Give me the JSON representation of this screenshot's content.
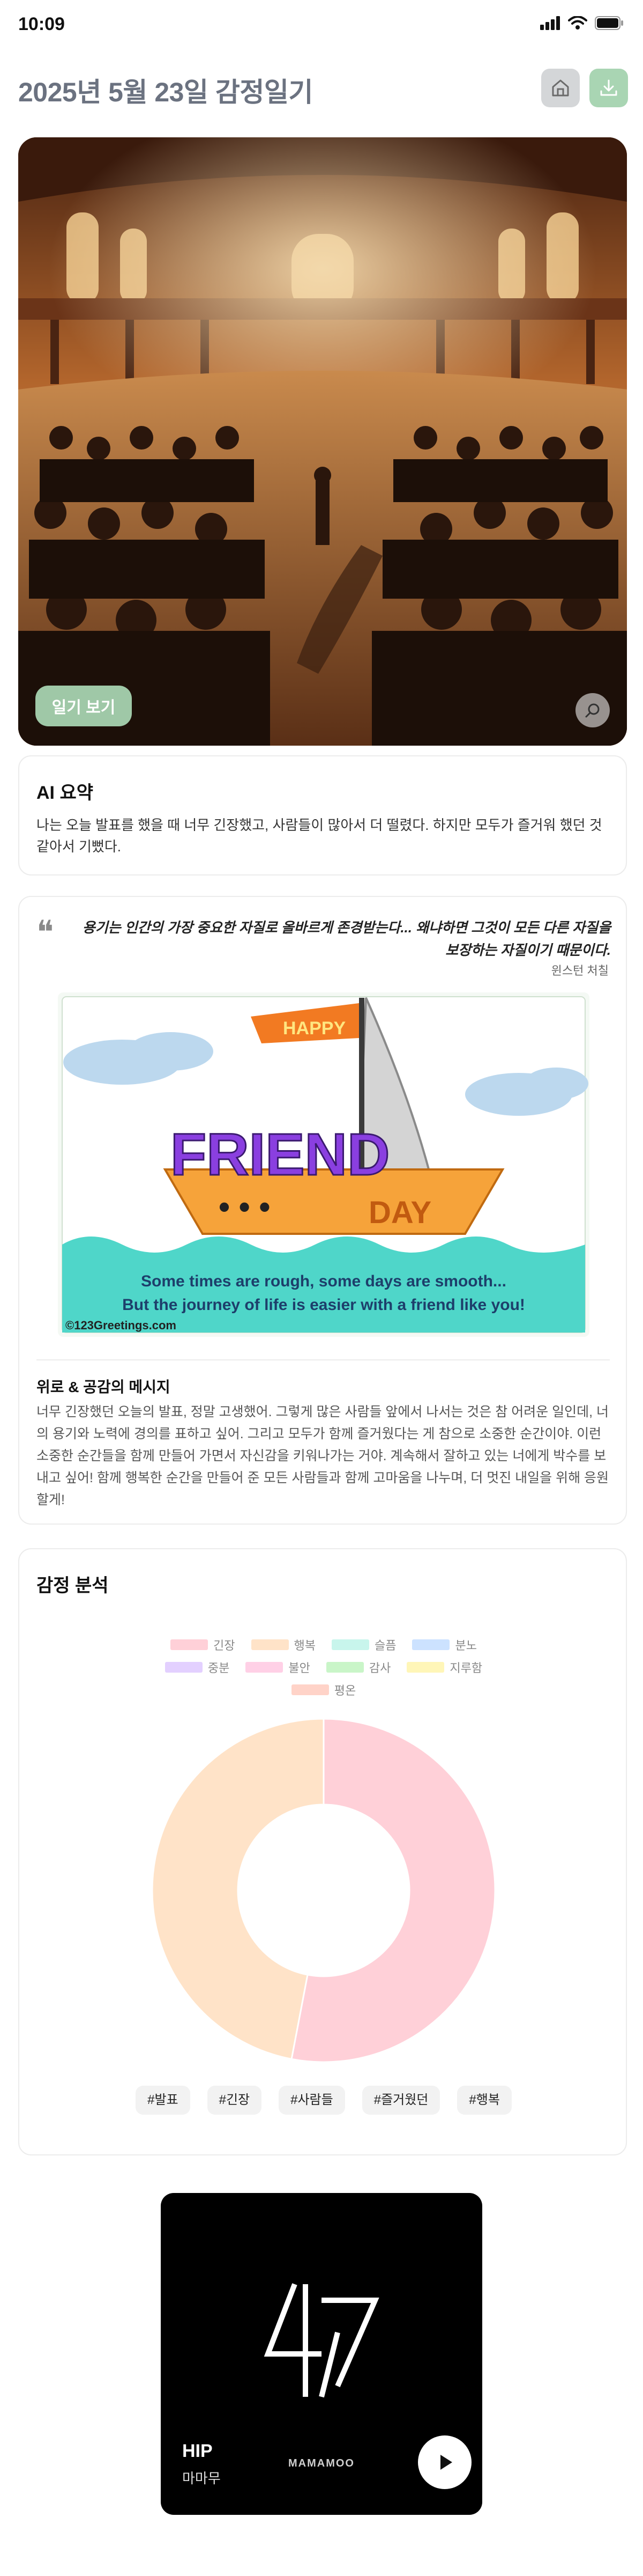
{
  "status_bar": {
    "time": "10:09"
  },
  "header": {
    "title": "2025년 5월 23일 감정일기"
  },
  "hero": {
    "diary_button": "일기 보기"
  },
  "ai_summary": {
    "title": "AI 요약",
    "text": "나는 오늘 발표를 했을 때 너무 긴장했고, 사람들이 많아서 더 떨렸다. 하지만 모두가 즐거워 했던 것 같아서 기뻤다."
  },
  "quote": {
    "text": "용기는 인간의 가장 중요한 자질로 올바르게 존경받는다... 왜냐하면 그것이 모든 다른 자질을 보장하는 자질이기 때문이다.",
    "author": "윈스턴 처칠"
  },
  "greeting_card": {
    "flag": "HAPPY",
    "word1": "FRIEND",
    "word2": "DAY",
    "line1": "Some times are rough, some days are smooth...",
    "line2": "But the journey of life is easier with a friend like you!",
    "credit": "©123Greetings.com"
  },
  "comfort": {
    "title": "위로 & 공감의 메시지",
    "text": "너무 긴장했던 오늘의 발표, 정말 고생했어. 그렇게 많은 사람들 앞에서 나서는 것은 참 어려운 일인데, 너의 용기와 노력에 경의를 표하고 싶어. 그리고 모두가 함께 즐거웠다는 게 참으로 소중한 순간이야. 이런 소중한 순간들을 함께 만들어 가면서 자신감을 키워나가는 거야. 계속해서 잘하고 있는 너에게 박수를 보내고 싶어! 함께 행복한 순간을 만들어 준 모든 사람들과 함께 고마움을 나누며, 더 멋진 내일을 위해 응원할게!"
  },
  "emotion": {
    "title": "감정 분석",
    "tags": [
      "#발표",
      "#긴장",
      "#사람들",
      "#즐거웠던",
      "#행복"
    ]
  },
  "chart_data": {
    "type": "pie",
    "legend": [
      "긴장",
      "행복",
      "슬픔",
      "분노",
      "중분",
      "불안",
      "감사",
      "지루함",
      "평온"
    ],
    "colors": [
      "#ffd0d8",
      "#ffe3c8",
      "#c8f5ec",
      "#cce2ff",
      "#e3d0ff",
      "#ffd0e6",
      "#c9f5c8",
      "#fff6b8",
      "#ffd3c8"
    ],
    "values": [
      53,
      47,
      0,
      0,
      0,
      0,
      0,
      0,
      0
    ],
    "legend_placement": "top"
  },
  "music": {
    "title": "HIP",
    "artist": "마마무",
    "brand": "MAMAMOO"
  }
}
